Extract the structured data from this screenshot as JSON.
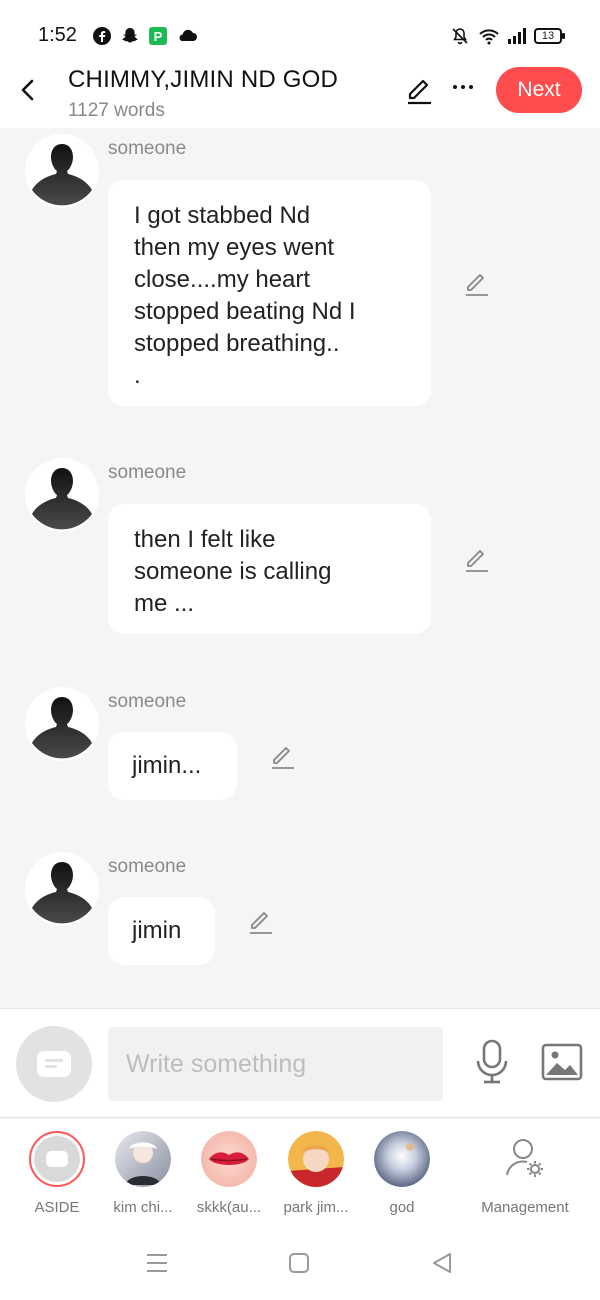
{
  "status": {
    "time": "1:52",
    "battery": "13",
    "left_icons": [
      "facebook-icon",
      "snapchat-icon",
      "app-badge-icon",
      "cloud-icon"
    ],
    "right_icons": [
      "bell-muted-icon",
      "wifi-icon",
      "signal-icon",
      "battery-icon"
    ]
  },
  "header": {
    "title": "CHIMMY,JIMIN ND GOD",
    "word_count": "1127 words",
    "next_label": "Next"
  },
  "messages": [
    {
      "sender": "someone",
      "text": "I got stabbed Nd\nthen my eyes went\nclose....my heart\nstopped beating Nd I\nstopped breathing..\n."
    },
    {
      "sender": "someone",
      "text": "then I felt like\nsomeone is calling\nme ..."
    },
    {
      "sender": "someone",
      "text": "jimin..."
    },
    {
      "sender": "someone",
      "text": "jimin"
    }
  ],
  "composer": {
    "placeholder": "Write something"
  },
  "characters": [
    {
      "label": "ASIDE"
    },
    {
      "label": "kim chi..."
    },
    {
      "label": "skkk(au..."
    },
    {
      "label": "park jim..."
    },
    {
      "label": "god"
    },
    {
      "label": "Management"
    }
  ],
  "colors": {
    "accent": "#ff4d4f",
    "background": "#f5f5f5",
    "bubble": "#ffffff",
    "muted_text": "#8a8a8a"
  }
}
